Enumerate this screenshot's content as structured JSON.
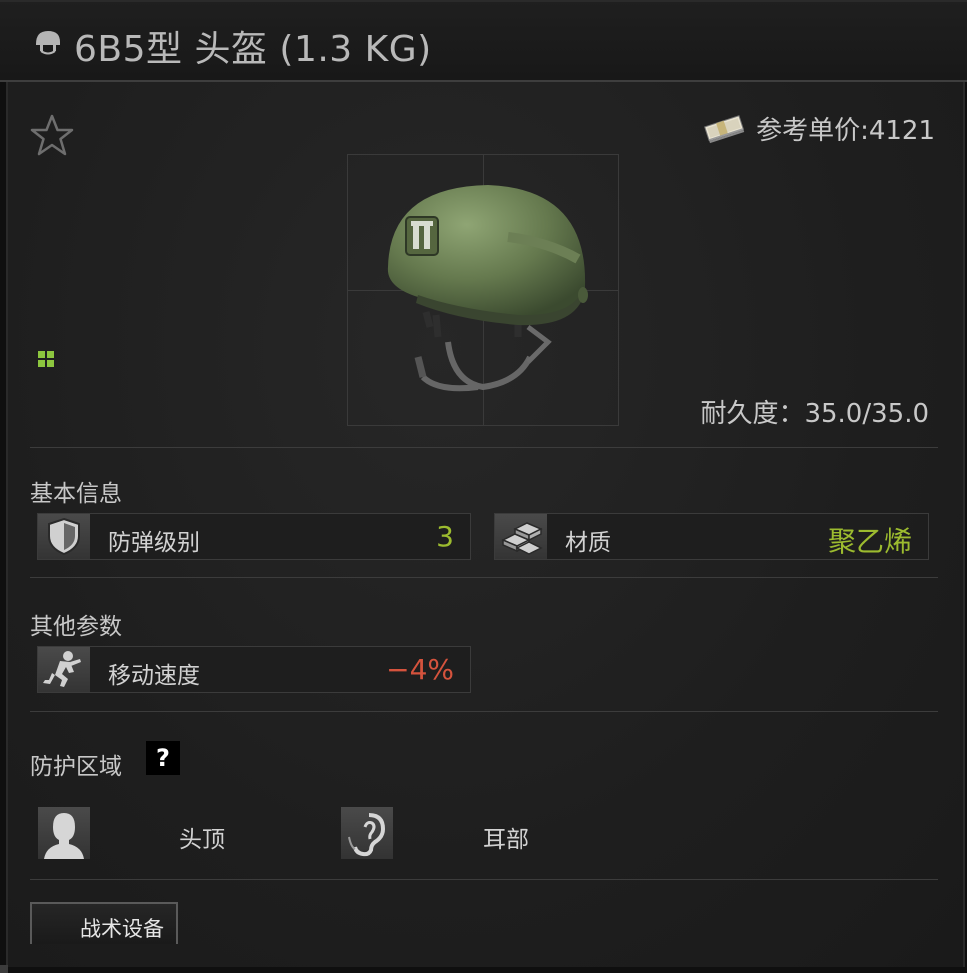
{
  "window": {
    "title": "6B5型 头盔 (1.3 KG)",
    "title_icon": "helmet-icon"
  },
  "item": {
    "favorite_icon": "star-outline-icon",
    "price_icon": "money-stack-icon",
    "price_text": "参考单价:4121",
    "image": "helmet-image",
    "grid_icon": "grid-icon",
    "durability_text": "耐久度：35.0/35.0"
  },
  "basic_info": {
    "title": "基本信息",
    "stats": [
      {
        "icon": "shield-icon",
        "label": "防弹级别",
        "value": "3",
        "value_color": "#9cbb2f"
      },
      {
        "icon": "material-bars-icon",
        "label": "材质",
        "value": "聚乙烯",
        "value_color": "#9cbb2f"
      }
    ]
  },
  "other_params": {
    "title": "其他参数",
    "stats": [
      {
        "icon": "running-soldier-icon",
        "label": "移动速度",
        "value": "−4%",
        "value_color": "#d5533d"
      }
    ]
  },
  "protection": {
    "title": "防护区域",
    "help_icon": "question-mark-icon",
    "help_label": "?",
    "zones": [
      {
        "icon": "head-silhouette-icon",
        "label": "头顶"
      },
      {
        "icon": "ear-icon",
        "label": "耳部"
      }
    ]
  },
  "tabs": {
    "tactical_label": "战术设备"
  },
  "colors": {
    "positive": "#9cbb2f",
    "negative": "#d5533d",
    "text": "#d2d2d2"
  }
}
